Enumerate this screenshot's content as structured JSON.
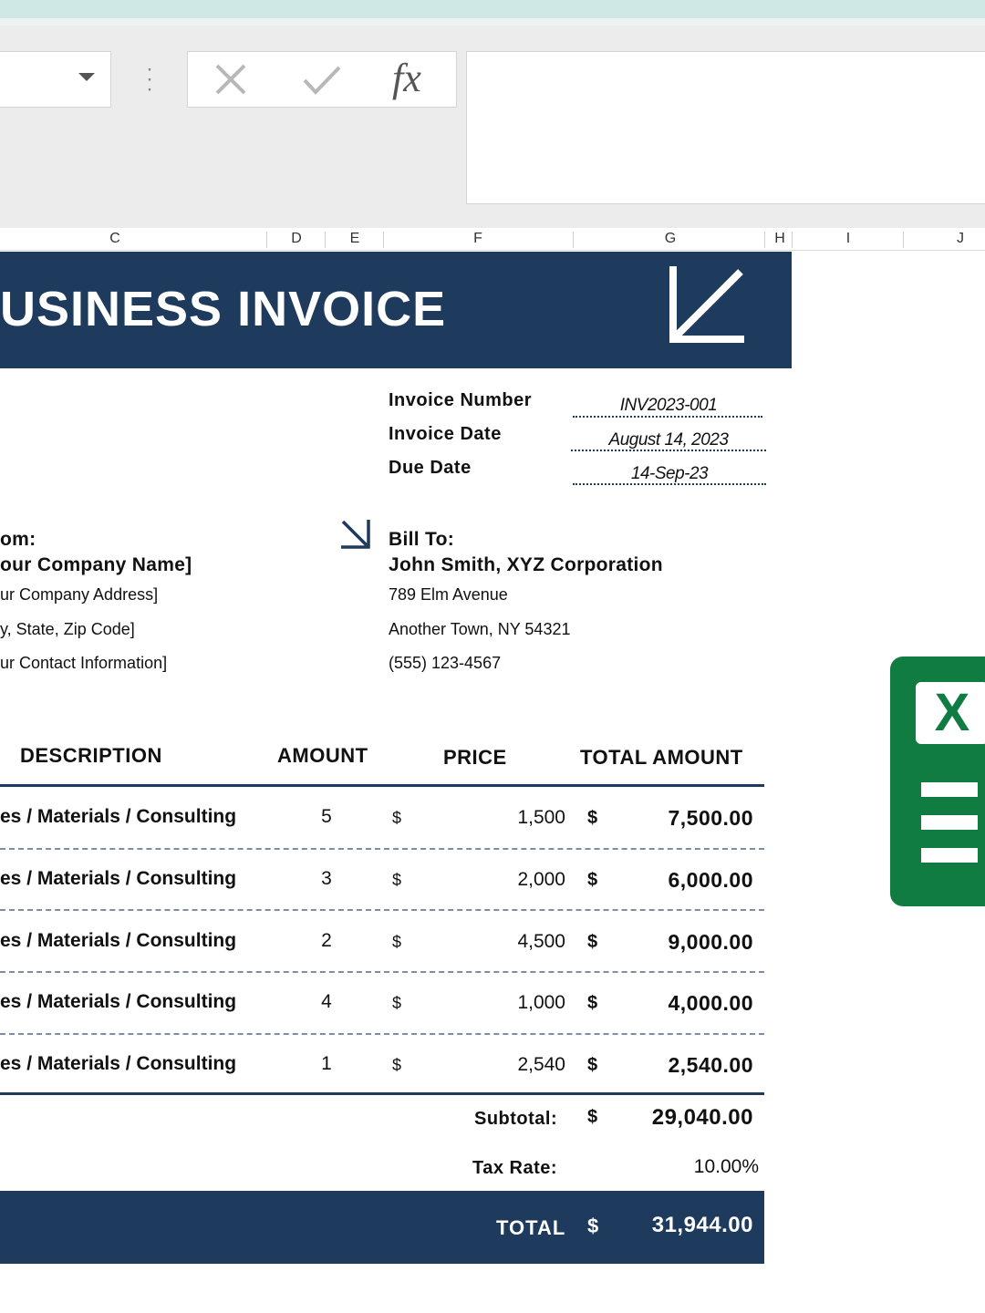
{
  "formula_bar": {
    "fx_label": "fx"
  },
  "columns": [
    "C",
    "D",
    "E",
    "F",
    "G",
    "H",
    "I",
    "J"
  ],
  "invoice": {
    "title": "USINESS INVOICE",
    "meta": [
      {
        "label": "Invoice Number",
        "value": "INV2023-001"
      },
      {
        "label": "Invoice Date",
        "value": "August 14, 2023"
      },
      {
        "label": "Due Date",
        "value": "14-Sep-23"
      }
    ],
    "from": {
      "heading": "om:",
      "name": "our Company Name]",
      "lines": [
        "ur Company Address]",
        "y, State, Zip Code]",
        "ur Contact Information]"
      ]
    },
    "bill_to": {
      "heading": "Bill To:",
      "name": "John Smith, XYZ Corporation",
      "lines": [
        "789 Elm Avenue",
        "Another Town, NY 54321",
        "(555) 123-4567"
      ]
    },
    "table": {
      "headers": {
        "description": "DESCRIPTION",
        "amount": "AMOUNT",
        "price": "PRICE",
        "total": "TOTAL AMOUNT"
      },
      "rows": [
        {
          "description": "es / Materials / Consulting",
          "qty": "5",
          "cur": "$",
          "price": "1,500",
          "cur2": "$",
          "total": "7,500.00"
        },
        {
          "description": "es / Materials / Consulting",
          "qty": "3",
          "cur": "$",
          "price": "2,000",
          "cur2": "$",
          "total": "6,000.00"
        },
        {
          "description": "es / Materials / Consulting",
          "qty": "2",
          "cur": "$",
          "price": "4,500",
          "cur2": "$",
          "total": "9,000.00"
        },
        {
          "description": "es / Materials / Consulting",
          "qty": "4",
          "cur": "$",
          "price": "1,000",
          "cur2": "$",
          "total": "4,000.00"
        },
        {
          "description": "es / Materials / Consulting",
          "qty": "1",
          "cur": "$",
          "price": "2,540",
          "cur2": "$",
          "total": "2,540.00"
        }
      ]
    },
    "subtotal": {
      "label": "Subtotal:",
      "cur": "$",
      "value": "29,040.00"
    },
    "tax": {
      "label": "Tax Rate:",
      "value": "10.00%"
    },
    "total": {
      "label": "TOTAL",
      "cur": "$",
      "value": "31,944.00"
    }
  },
  "logo": {
    "letter": "X",
    "name": "excel-logo",
    "color": "#107c41"
  },
  "colors": {
    "banner": "#1e3a5c",
    "excel_green": "#107c41"
  }
}
